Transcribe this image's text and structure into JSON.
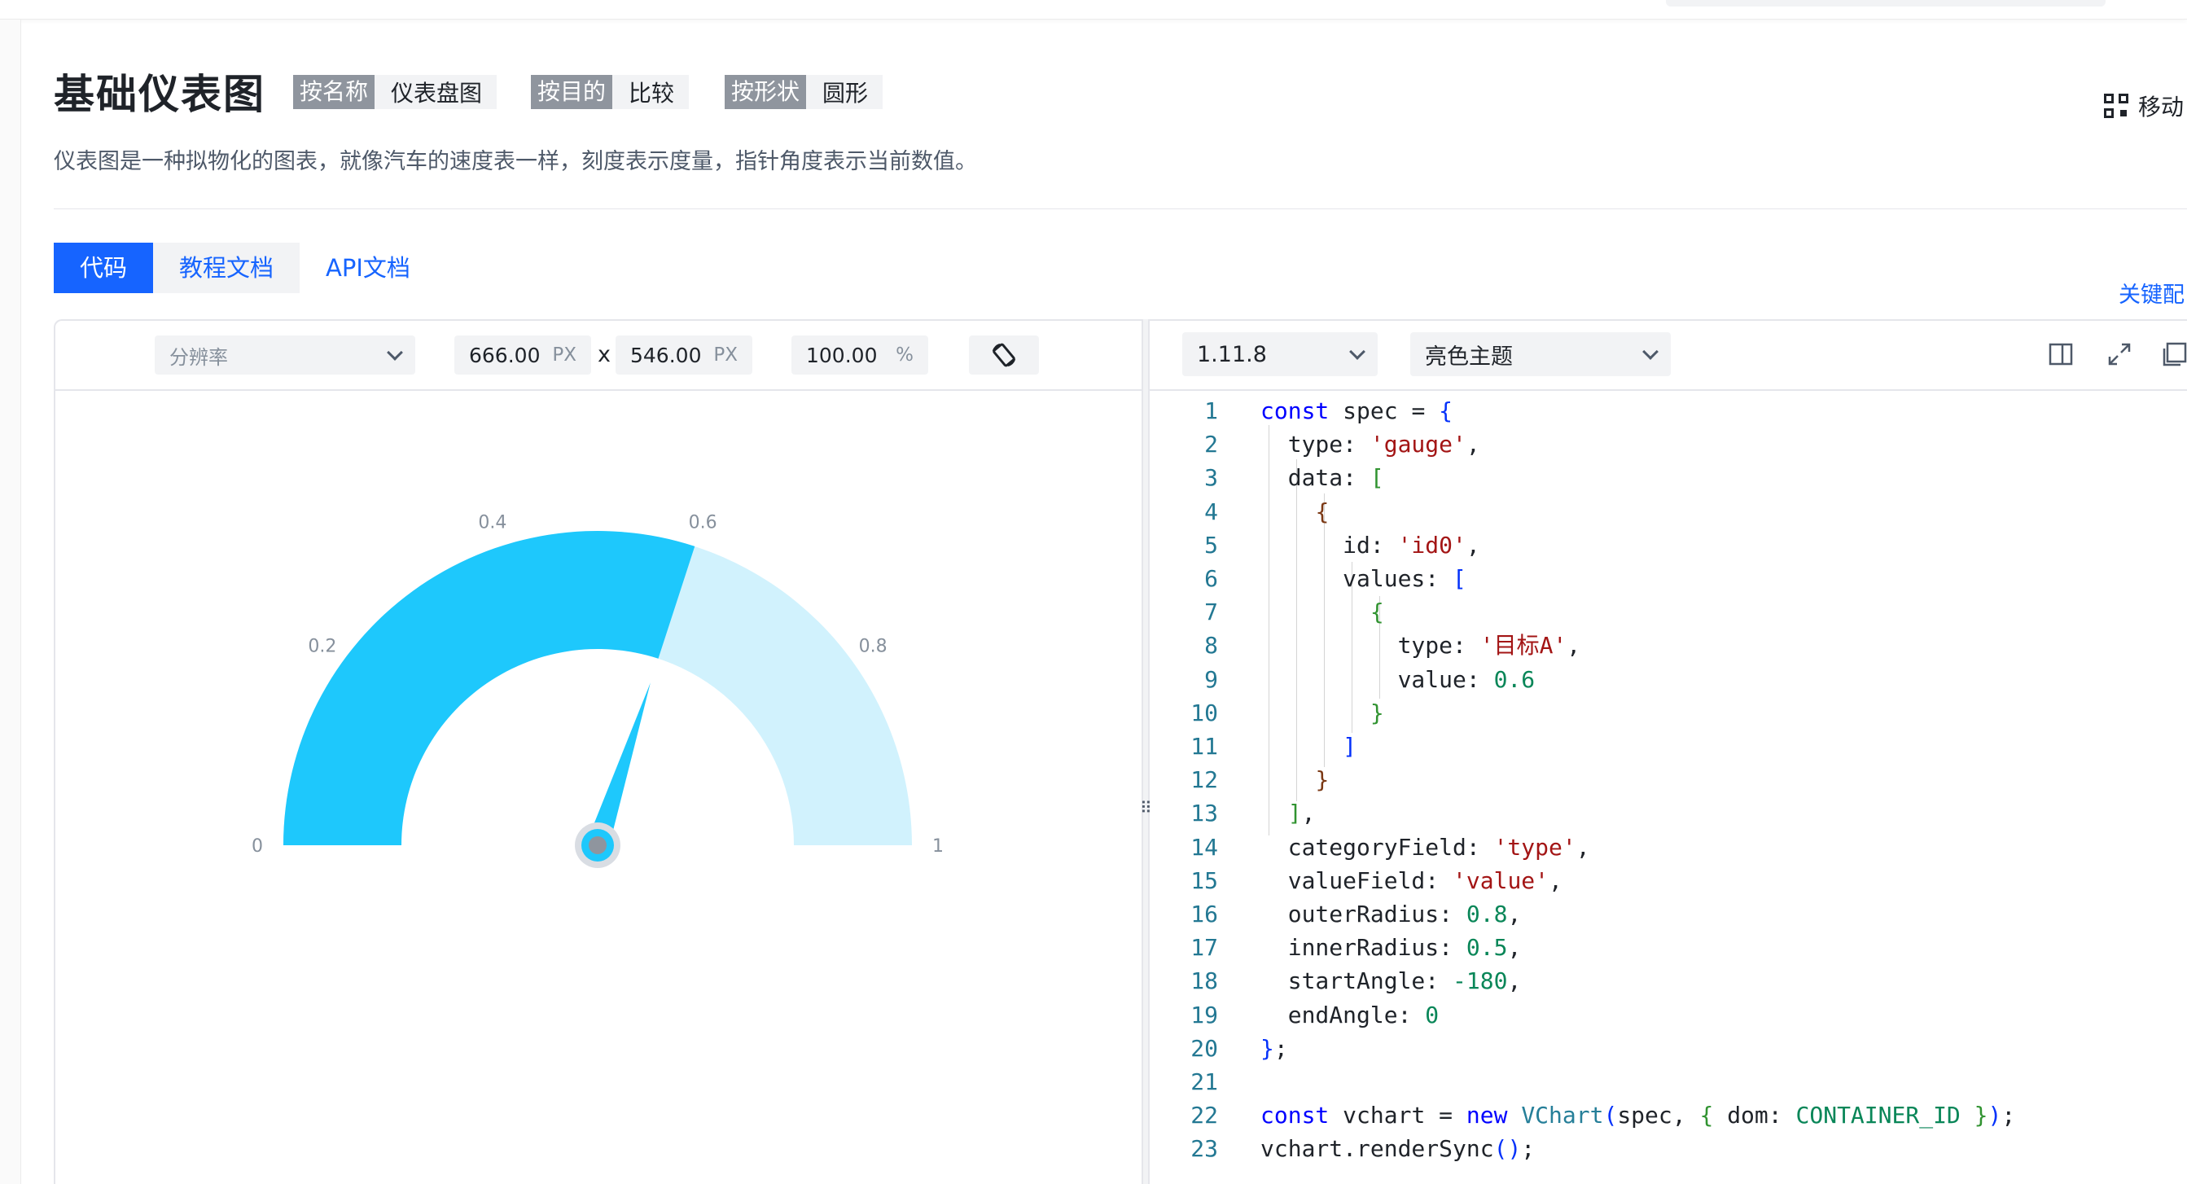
{
  "header": {
    "title": "基础仪表图",
    "tags": [
      {
        "key": "按名称",
        "value": "仪表盘图"
      },
      {
        "key": "按目的",
        "value": "比较"
      },
      {
        "key": "按形状",
        "value": "圆形"
      }
    ],
    "description": "仪表图是一种拟物化的图表，就像汽车的速度表一样，刻度表示度量，指针角度表示当前数值。",
    "mobile_label": "移动"
  },
  "tabs": [
    {
      "label": "代码",
      "active": true
    },
    {
      "label": "教程文档",
      "active": false
    },
    {
      "label": "API文档",
      "active": false
    }
  ],
  "shortcut_label": "关键配",
  "preview_toolbar": {
    "resolution_placeholder": "分辨率",
    "width": "666.00",
    "height": "546.00",
    "unit_px": "PX",
    "times": "x",
    "zoom": "100.00",
    "unit_percent": "%"
  },
  "editor_toolbar": {
    "version": "1.11.8",
    "theme": "亮色主题"
  },
  "chart_data": {
    "type": "gauge",
    "categories": [
      "目标A"
    ],
    "values": [
      0.6
    ],
    "min": 0,
    "max": 1,
    "tick_labels": [
      "0",
      "0.2",
      "0.4",
      "0.6",
      "0.8",
      "1"
    ],
    "colors": {
      "fill": "#1ec8fc",
      "track": "#d1f2fd",
      "pointer": "#1ec8fc",
      "pin": "#8f959e"
    }
  },
  "code_lines": [
    "const spec = {",
    "  type: 'gauge',",
    "  data: [",
    "    {",
    "      id: 'id0',",
    "      values: [",
    "        {",
    "          type: '目标A',",
    "          value: 0.6",
    "        }",
    "      ]",
    "    }",
    "  ],",
    "  categoryField: 'type',",
    "  valueField: 'value',",
    "  outerRadius: 0.8,",
    "  innerRadius: 0.5,",
    "  startAngle: -180,",
    "  endAngle: 0",
    "};",
    "",
    "const vchart = new VChart(spec, { dom: CONTAINER_ID });",
    "vchart.renderSync();"
  ]
}
